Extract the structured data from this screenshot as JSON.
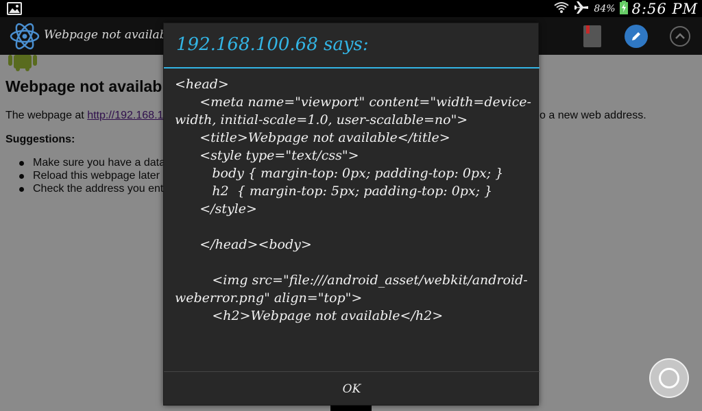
{
  "status_bar": {
    "battery_percent": "84%",
    "time": "8:56 PM"
  },
  "action_bar": {
    "title": "Webpage not availabl"
  },
  "page": {
    "heading": "Webpage not availabl",
    "text_start": "The webpage at ",
    "link": "http://192.168.1",
    "text_end": "o a new web address.",
    "suggestions_label": "Suggestions:",
    "suggestions": [
      "Make sure you have a data",
      "Reload this webpage later",
      "Check the address you ent"
    ]
  },
  "dialog": {
    "title": "192.168.100.68 says:",
    "message": "<head>\n      <meta name=\"viewport\" content=\"width=device-width, initial-scale=1.0, user-scalable=no\">\n      <title>Webpage not available</title>\n      <style type=\"text/css\">\n         body { margin-top: 0px; padding-top: 0px; }\n         h2  { margin-top: 5px; padding-top: 0px; }\n      </style>\n\n      </head><body>\n\n         <img src=\"file:///android_asset/webkit/android-weberror.png\" align=\"top\">\n         <h2>Webpage not available</h2>",
    "ok_label": "OK"
  },
  "colors": {
    "accent": "#33b5e5",
    "dialog_bg": "#282828",
    "edit_button": "#2f78c4"
  }
}
